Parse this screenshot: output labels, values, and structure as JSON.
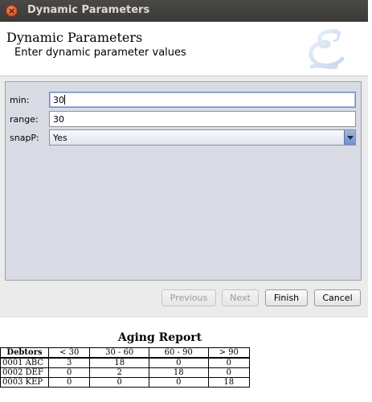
{
  "window": {
    "title": "Dynamic Parameters",
    "close_glyph": "×"
  },
  "header": {
    "title": "Dynamic Parameters",
    "subtitle": "Enter dynamic parameter values",
    "logo_icon": "script-e-logo"
  },
  "form": {
    "fields": [
      {
        "label": "min:",
        "value": "30",
        "focused": true
      },
      {
        "label": "range:",
        "value": "30"
      },
      {
        "label": "snapP:",
        "value": "Yes",
        "type": "select"
      }
    ]
  },
  "buttons": {
    "previous": "Previous",
    "next": "Next",
    "finish": "Finish",
    "cancel": "Cancel"
  },
  "report": {
    "title": "Aging Report",
    "columns": [
      "Debtors",
      "< 30",
      "30 - 60",
      "60 - 90",
      "> 90"
    ],
    "rows": [
      [
        "0001 ABC",
        "3",
        "18",
        "0",
        "0"
      ],
      [
        "0002 DEF",
        "0",
        "2",
        "18",
        "0"
      ],
      [
        "0003 KEP",
        "0",
        "0",
        "0",
        "18"
      ]
    ]
  },
  "colors": {
    "titlebar": "#3c3b37",
    "close_button": "#e05a2b",
    "form_background": "#d9dbe4",
    "panel_background": "#ebebeb"
  }
}
